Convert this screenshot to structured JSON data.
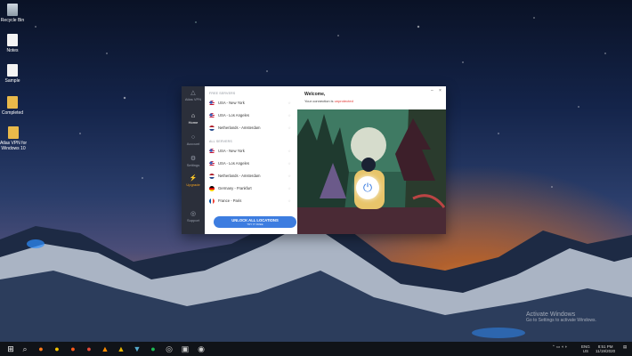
{
  "desktop": {
    "icons": [
      {
        "label": "Recycle Bin",
        "icon": "recycle-bin-icon",
        "type": "bin"
      },
      {
        "label": "Notes",
        "icon": "document-icon",
        "type": "doc"
      },
      {
        "label": "Sample",
        "icon": "document-icon",
        "type": "doc"
      },
      {
        "label": "Completed",
        "icon": "folder-icon",
        "type": "folder"
      },
      {
        "label": "Atlas VPN for Windows 10",
        "icon": "folder-icon",
        "type": "folder"
      }
    ],
    "activation": {
      "title": "Activate Windows",
      "subtitle": "Go to Settings to activate Windows."
    }
  },
  "vpn": {
    "sidebar": [
      {
        "label": "Atlas VPN",
        "icon": "atlas-logo-icon"
      },
      {
        "label": "Home",
        "icon": "home-icon"
      },
      {
        "label": "Account",
        "icon": "account-icon"
      },
      {
        "label": "Settings",
        "icon": "gear-icon"
      },
      {
        "label": "Upgrade",
        "icon": "lightning-icon"
      },
      {
        "label": "Support",
        "icon": "support-icon"
      }
    ],
    "free_section": "FREE SERVERS",
    "free_locations": [
      "USA - New York",
      "USA - Los Angeles",
      "Netherlands - Amsterdam"
    ],
    "all_section": "ALL SERVERS",
    "all_locations": [
      "USA - New York",
      "USA - Los Angeles",
      "Netherlands - Amsterdam",
      "Germany - Frankfurt",
      "France - Paris"
    ],
    "unlock_button": {
      "title": "UNLOCK ALL LOCATIONS",
      "subtitle": "TRY IT FREE"
    },
    "header": {
      "welcome": "Welcome,",
      "status_prefix": "Your connection is",
      "status_value": "unprotected"
    },
    "window_controls": {
      "minimize": "–",
      "close": "×"
    },
    "power_icon": "power-icon",
    "colors": {
      "accent": "#3d7de0",
      "unprotected": "#e0352f",
      "upgrade": "#f0a020",
      "sidebar": "#2b2f3a"
    }
  },
  "taskbar": {
    "apps": [
      "windows-start-icon",
      "search-icon",
      "firefox-icon",
      "chrome-icon",
      "firefox-icon",
      "chrome-icon",
      "vlc-icon",
      "app-icon",
      "spotify-icon",
      "app-icon",
      "app-icon",
      "chrome-icon"
    ],
    "language": "ENG",
    "region": "US",
    "time": "8:51 PM",
    "date": "11/19/2020"
  }
}
